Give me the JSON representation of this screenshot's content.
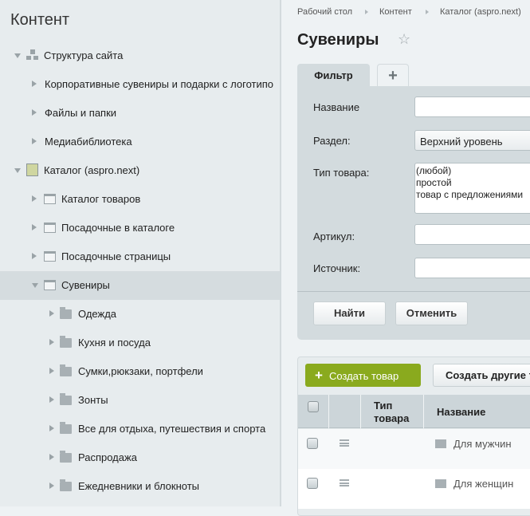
{
  "sidebar": {
    "title": "Контент",
    "items": [
      {
        "label": "Структура сайта",
        "icon": "site-structure-icon",
        "level": 0,
        "expanded": true
      },
      {
        "label": "Корпоративные сувениры и подарки с логотипо",
        "level": 1
      },
      {
        "label": "Файлы и папки",
        "level": 1
      },
      {
        "label": "Медиабиблиотека",
        "level": 1
      },
      {
        "label": "Каталог (aspro.next)",
        "icon": "catalog-icon",
        "level": 0,
        "expanded": true
      },
      {
        "label": "Каталог товаров",
        "icon": "iblock-icon",
        "level": 1
      },
      {
        "label": "Посадочные в каталоге",
        "icon": "iblock-icon",
        "level": 1
      },
      {
        "label": "Посадочные страницы",
        "icon": "iblock-icon",
        "level": 1
      },
      {
        "label": "Сувениры",
        "icon": "iblock-icon",
        "level": 1,
        "expanded": true,
        "selected": true
      },
      {
        "label": "Одежда",
        "icon": "folder-icon",
        "level": 2
      },
      {
        "label": "Кухня и посуда",
        "icon": "folder-icon",
        "level": 2
      },
      {
        "label": "Сумки,рюкзаки, портфели",
        "icon": "folder-icon",
        "level": 2
      },
      {
        "label": "Зонты",
        "icon": "folder-icon",
        "level": 2
      },
      {
        "label": "Все для отдыха, путешествия и спорта",
        "icon": "folder-icon",
        "level": 2
      },
      {
        "label": "Распродажа",
        "icon": "folder-icon",
        "level": 2
      },
      {
        "label": "Ежедневники и блокноты",
        "icon": "folder-icon",
        "level": 2
      }
    ]
  },
  "breadcrumb": [
    "Рабочий стол",
    "Контент",
    "Каталог (aspro.next)"
  ],
  "page": {
    "title": "Сувениры"
  },
  "filter": {
    "tab": "Фильтр",
    "add_tab": "+",
    "name_label": "Название",
    "name_value": "",
    "section_label": "Раздел:",
    "section_value": "Верхний уровень",
    "type_label": "Тип товара:",
    "type_options": [
      "(любой)",
      "простой",
      "товар с предложениями"
    ],
    "article_label": "Артикул:",
    "article_value": "",
    "source_label": "Источник:",
    "source_value": "",
    "find": "Найти",
    "cancel": "Отменить"
  },
  "grid": {
    "create": "Создать товар",
    "create_other": "Создать другие т",
    "headers": {
      "type": "Тип товара",
      "name": "Название"
    },
    "rows": [
      {
        "name": "Для мужчин"
      },
      {
        "name": "Для женщин"
      }
    ]
  },
  "colors": {
    "accent": "#8aaa1e"
  }
}
